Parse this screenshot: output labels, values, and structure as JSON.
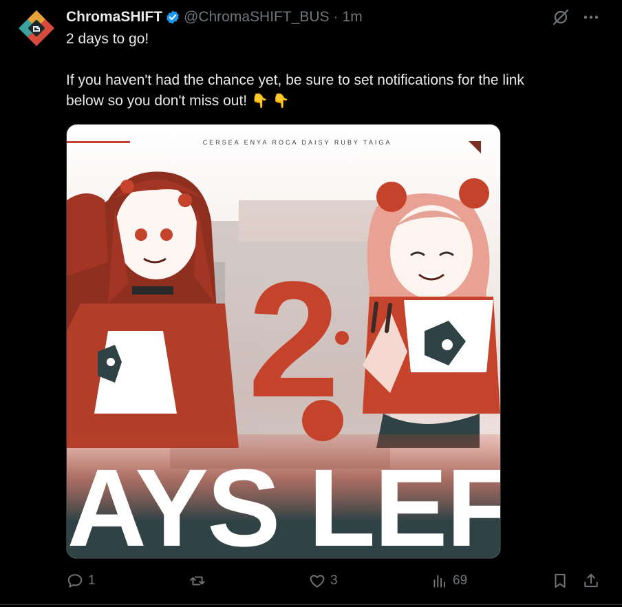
{
  "post": {
    "author": {
      "display_name": "ChromaSHIFT",
      "handle": "@ChromaSHIFT_BUS",
      "verified_icon": "verified-badge-icon"
    },
    "separator": "·",
    "time": "1m",
    "text_lines": [
      "2 days to go!",
      "If you haven't had the chance yet, be sure to set notifications for the link",
      "below so you don't miss out!"
    ],
    "emoji": "👇 👇",
    "media": {
      "member_names": "CERSEA   ENYA   ROCA   DAISY   RUBY   TAIGA",
      "big_number": "2",
      "banner": "DAYS LEFT"
    },
    "stats": {
      "replies": "1",
      "reposts": "",
      "likes": "3",
      "views": "69"
    }
  },
  "colors": {
    "background": "#000000",
    "text": "#e7e9ea",
    "muted": "#71767b",
    "verified": "#1d9bf0",
    "accent_red": "#c5432a",
    "dark_teal": "#2f4346"
  }
}
